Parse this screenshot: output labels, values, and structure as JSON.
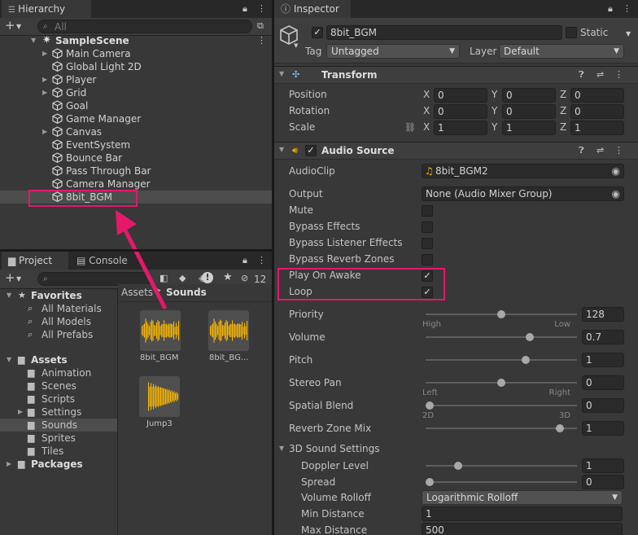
{
  "hierarchy": {
    "tab_label": "Hierarchy",
    "search_placeholder": "All",
    "scene_name": "SampleScene",
    "items": [
      {
        "label": "Main Camera",
        "fold": true
      },
      {
        "label": "Global Light 2D",
        "fold": false
      },
      {
        "label": "Player",
        "fold": true
      },
      {
        "label": "Grid",
        "fold": true
      },
      {
        "label": "Goal",
        "fold": false
      },
      {
        "label": "Game Manager",
        "fold": false
      },
      {
        "label": "Canvas",
        "fold": true
      },
      {
        "label": "EventSystem",
        "fold": false
      },
      {
        "label": "Bounce Bar",
        "fold": false
      },
      {
        "label": "Pass Through Bar",
        "fold": false
      },
      {
        "label": "Camera Manager",
        "fold": false
      },
      {
        "label": "8bit_BGM",
        "fold": false
      }
    ]
  },
  "project": {
    "tab_project": "Project",
    "tab_console": "Console",
    "hidden_count": "12",
    "breadcrumb": [
      "Assets",
      "Sounds"
    ],
    "favorites_label": "Favorites",
    "favorites": [
      "All Materials",
      "All Models",
      "All Prefabs"
    ],
    "assets_label": "Assets",
    "asset_folders": [
      "Animation",
      "Scenes",
      "Scripts",
      "Settings",
      "Sounds",
      "Sprites",
      "Tiles"
    ],
    "packages_label": "Packages",
    "files": [
      "8bit_BGM",
      "8bit_BG...",
      "Jump3"
    ]
  },
  "inspector": {
    "tab_label": "Inspector",
    "object_name": "8bit_BGM",
    "static_label": "Static",
    "tag_label": "Tag",
    "tag_value": "Untagged",
    "layer_label": "Layer",
    "layer_value": "Default",
    "transform": {
      "title": "Transform",
      "rows": [
        {
          "label": "Position",
          "x": "0",
          "y": "0",
          "z": "0"
        },
        {
          "label": "Rotation",
          "x": "0",
          "y": "0",
          "z": "0"
        },
        {
          "label": "Scale",
          "x": "1",
          "y": "1",
          "z": "1"
        }
      ],
      "axis_x": "X",
      "axis_y": "Y",
      "axis_z": "Z"
    },
    "audio": {
      "title": "Audio Source",
      "clip_label": "AudioClip",
      "clip_value": "8bit_BGM2",
      "output_label": "Output",
      "output_value": "None (Audio Mixer Group)",
      "toggles": [
        {
          "label": "Mute",
          "checked": false
        },
        {
          "label": "Bypass Effects",
          "checked": false
        },
        {
          "label": "Bypass Listener Effects",
          "checked": false
        },
        {
          "label": "Bypass Reverb Zones",
          "checked": false
        },
        {
          "label": "Play On Awake",
          "checked": true
        },
        {
          "label": "Loop",
          "checked": true
        }
      ],
      "priority": {
        "label": "Priority",
        "value": "128",
        "min_cap": "High",
        "max_cap": "Low",
        "fraction": 0.5
      },
      "volume": {
        "label": "Volume",
        "value": "0.7",
        "fraction": 0.7
      },
      "pitch": {
        "label": "Pitch",
        "value": "1",
        "fraction": 0.67
      },
      "stereo": {
        "label": "Stereo Pan",
        "value": "0",
        "min_cap": "Left",
        "max_cap": "Right",
        "fraction": 0.5
      },
      "spatial": {
        "label": "Spatial Blend",
        "value": "0",
        "min_cap": "2D",
        "max_cap": "3D",
        "fraction": 0.0
      },
      "reverb": {
        "label": "Reverb Zone Mix",
        "value": "1",
        "fraction": 0.91
      }
    },
    "sound3d": {
      "title": "3D Sound Settings",
      "doppler": {
        "label": "Doppler Level",
        "value": "1",
        "fraction": 0.2
      },
      "spread": {
        "label": "Spread",
        "value": "0",
        "fraction": 0.0
      },
      "rolloff_label": "Volume Rolloff",
      "rolloff_value": "Logarithmic Rolloff",
      "min_label": "Min Distance",
      "min_value": "1",
      "max_label": "Max Distance",
      "max_value": "500"
    }
  },
  "colors": {
    "highlight": "#e5196a",
    "audio_yellow": "#f5b400",
    "selection": "#4d4d4d"
  }
}
